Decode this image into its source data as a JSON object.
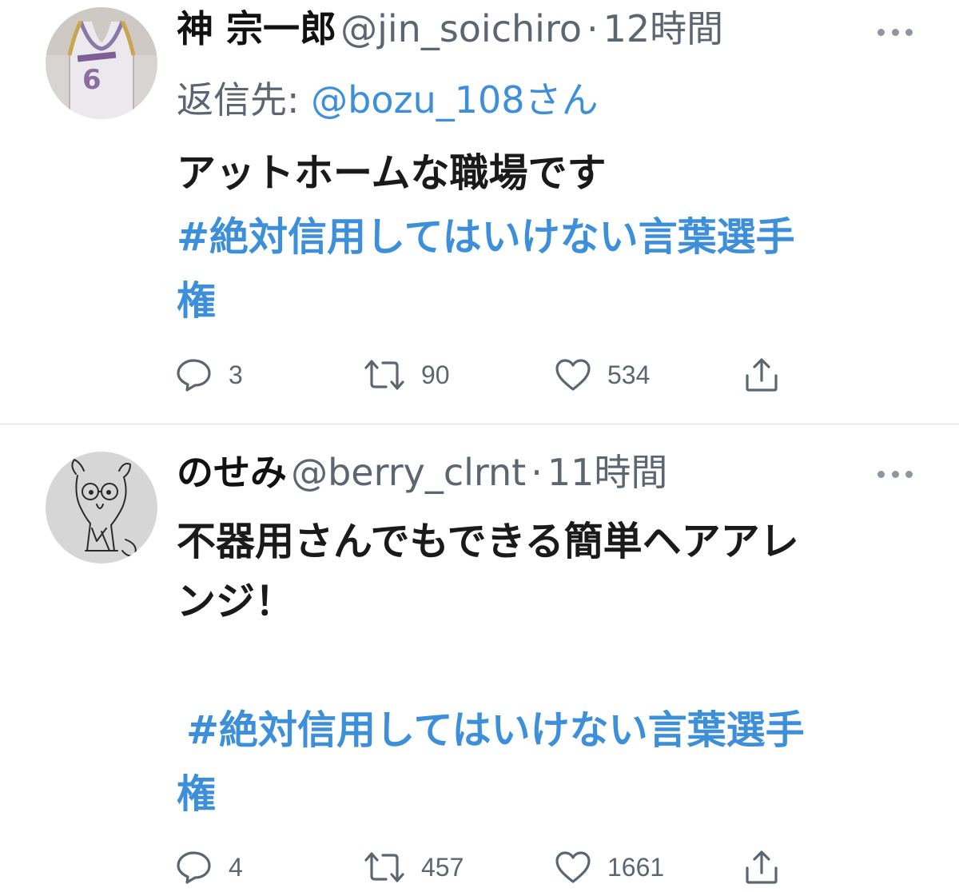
{
  "tweets": [
    {
      "name": "神 宗一郎",
      "handle": "@jin_soichiro",
      "dot": "·",
      "time": "12時間",
      "reply_label": "返信先:",
      "reply_to": "@bozu_108さん",
      "text_lines": [
        "アットホームな職場です"
      ],
      "hashtag_lines": [
        "#絶対信用してはいけない言葉選手",
        "権"
      ],
      "replies": "3",
      "retweets": "90",
      "likes": "534",
      "avatar_icon": "basketball-jersey-avatar"
    },
    {
      "name": "のせみ",
      "handle": "@berry_clrnt",
      "dot": "·",
      "time": "11時間",
      "text_lines": [
        "不器用さんでもできる簡単ヘアアレ",
        "ンジ！"
      ],
      "hashtag_lines": [
        "#絶対信用してはいけない言葉選手",
        "権"
      ],
      "replies": "4",
      "retweets": "457",
      "likes": "1661",
      "avatar_icon": "cat-sketch-avatar"
    }
  ],
  "icons": {
    "reply": "reply-icon",
    "retweet": "retweet-icon",
    "like": "heart-icon",
    "share": "share-icon",
    "more": "more-icon"
  },
  "colors": {
    "link": "#3d8fd9",
    "muted": "#5b6670",
    "text": "#1a1a1a"
  }
}
